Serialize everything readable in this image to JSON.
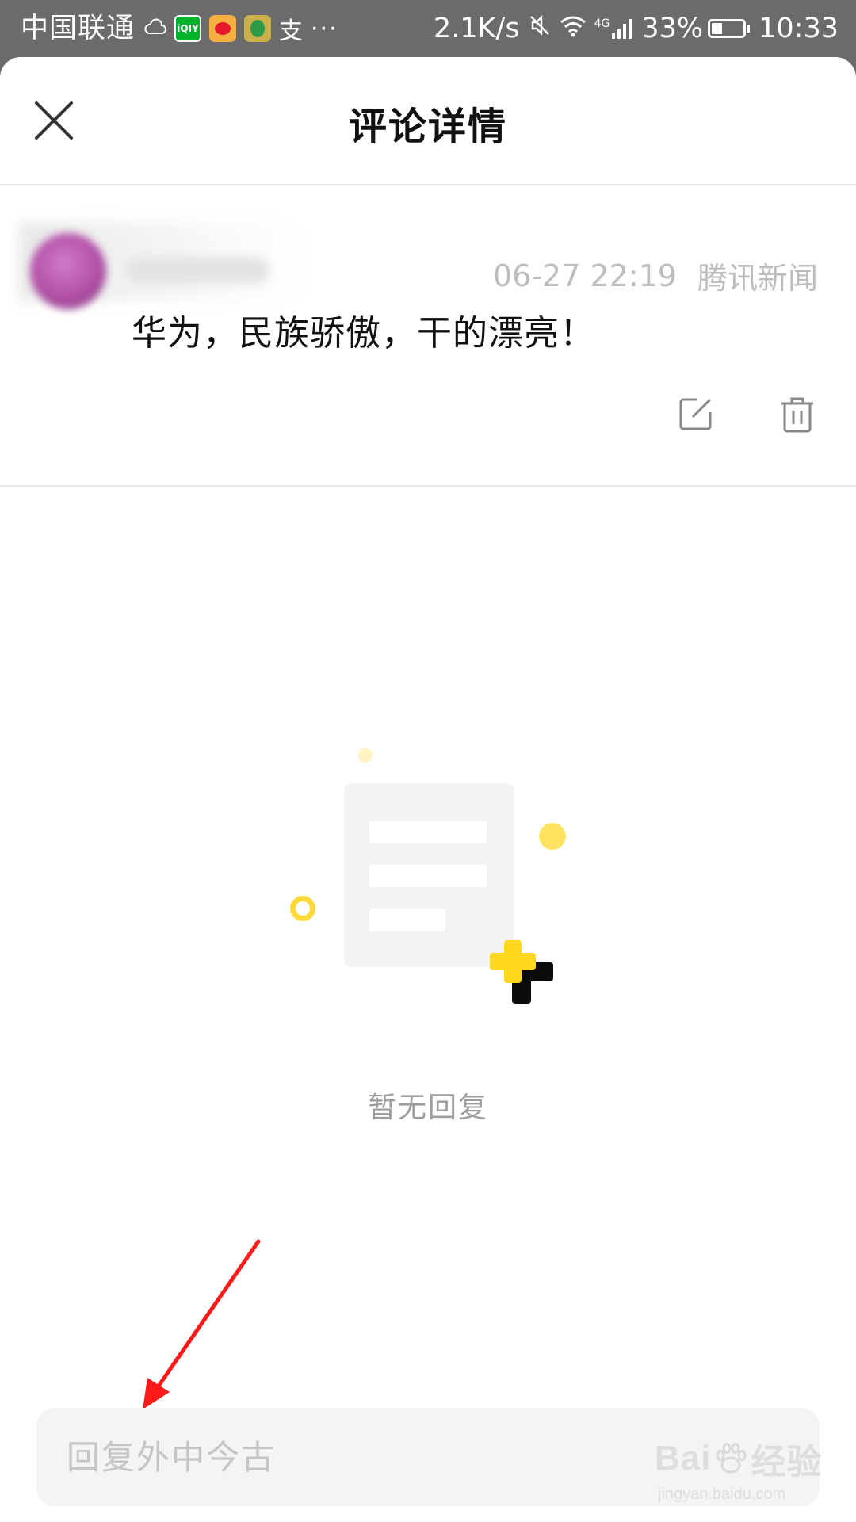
{
  "status_bar": {
    "carrier": "中国联通",
    "network_speed": "2.1K/s",
    "network_type": "4G",
    "battery_percent": "33%",
    "battery_level": 0.33,
    "time": "10:33",
    "app_icon_names": [
      "cloud-weather-icon",
      "iqiyi-app-icon",
      "weibo-app-icon",
      "qq-app-icon",
      "alipay-icon",
      "more-dots-icon"
    ]
  },
  "header": {
    "title": "评论详情",
    "close_icon": "close-icon"
  },
  "comment": {
    "timestamp": "06-27 22:19",
    "source": "腾讯新闻",
    "text": "华为，民族骄傲，干的漂亮！",
    "actions": [
      "edit-icon",
      "delete-icon"
    ]
  },
  "empty_state": {
    "text": "暂无回复"
  },
  "reply": {
    "placeholder": "回复外中今古"
  },
  "watermark": {
    "brand_left": "Bai",
    "brand_right": "经验",
    "url": "jingyan.baidu.com"
  },
  "colors": {
    "status_bar_bg": "#6b6b6b",
    "accent_yellow": "#ffd71e",
    "annotation_arrow": "#ff1a1a"
  }
}
